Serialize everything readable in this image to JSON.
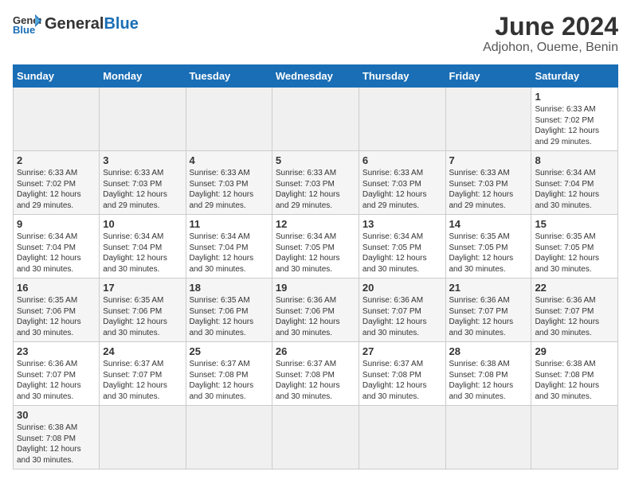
{
  "header": {
    "logo_general": "General",
    "logo_blue": "Blue",
    "title": "June 2024",
    "subtitle": "Adjohon, Oueme, Benin"
  },
  "days_of_week": [
    "Sunday",
    "Monday",
    "Tuesday",
    "Wednesday",
    "Thursday",
    "Friday",
    "Saturday"
  ],
  "weeks": [
    [
      {
        "day": "",
        "info": ""
      },
      {
        "day": "",
        "info": ""
      },
      {
        "day": "",
        "info": ""
      },
      {
        "day": "",
        "info": ""
      },
      {
        "day": "",
        "info": ""
      },
      {
        "day": "",
        "info": ""
      },
      {
        "day": "1",
        "info": "Sunrise: 6:33 AM\nSunset: 7:02 PM\nDaylight: 12 hours and 29 minutes."
      }
    ],
    [
      {
        "day": "2",
        "info": "Sunrise: 6:33 AM\nSunset: 7:02 PM\nDaylight: 12 hours and 29 minutes."
      },
      {
        "day": "3",
        "info": "Sunrise: 6:33 AM\nSunset: 7:03 PM\nDaylight: 12 hours and 29 minutes."
      },
      {
        "day": "4",
        "info": "Sunrise: 6:33 AM\nSunset: 7:03 PM\nDaylight: 12 hours and 29 minutes."
      },
      {
        "day": "5",
        "info": "Sunrise: 6:33 AM\nSunset: 7:03 PM\nDaylight: 12 hours and 29 minutes."
      },
      {
        "day": "6",
        "info": "Sunrise: 6:33 AM\nSunset: 7:03 PM\nDaylight: 12 hours and 29 minutes."
      },
      {
        "day": "7",
        "info": "Sunrise: 6:33 AM\nSunset: 7:03 PM\nDaylight: 12 hours and 29 minutes."
      },
      {
        "day": "8",
        "info": "Sunrise: 6:34 AM\nSunset: 7:04 PM\nDaylight: 12 hours and 30 minutes."
      }
    ],
    [
      {
        "day": "9",
        "info": "Sunrise: 6:34 AM\nSunset: 7:04 PM\nDaylight: 12 hours and 30 minutes."
      },
      {
        "day": "10",
        "info": "Sunrise: 6:34 AM\nSunset: 7:04 PM\nDaylight: 12 hours and 30 minutes."
      },
      {
        "day": "11",
        "info": "Sunrise: 6:34 AM\nSunset: 7:04 PM\nDaylight: 12 hours and 30 minutes."
      },
      {
        "day": "12",
        "info": "Sunrise: 6:34 AM\nSunset: 7:05 PM\nDaylight: 12 hours and 30 minutes."
      },
      {
        "day": "13",
        "info": "Sunrise: 6:34 AM\nSunset: 7:05 PM\nDaylight: 12 hours and 30 minutes."
      },
      {
        "day": "14",
        "info": "Sunrise: 6:35 AM\nSunset: 7:05 PM\nDaylight: 12 hours and 30 minutes."
      },
      {
        "day": "15",
        "info": "Sunrise: 6:35 AM\nSunset: 7:05 PM\nDaylight: 12 hours and 30 minutes."
      }
    ],
    [
      {
        "day": "16",
        "info": "Sunrise: 6:35 AM\nSunset: 7:06 PM\nDaylight: 12 hours and 30 minutes."
      },
      {
        "day": "17",
        "info": "Sunrise: 6:35 AM\nSunset: 7:06 PM\nDaylight: 12 hours and 30 minutes."
      },
      {
        "day": "18",
        "info": "Sunrise: 6:35 AM\nSunset: 7:06 PM\nDaylight: 12 hours and 30 minutes."
      },
      {
        "day": "19",
        "info": "Sunrise: 6:36 AM\nSunset: 7:06 PM\nDaylight: 12 hours and 30 minutes."
      },
      {
        "day": "20",
        "info": "Sunrise: 6:36 AM\nSunset: 7:07 PM\nDaylight: 12 hours and 30 minutes."
      },
      {
        "day": "21",
        "info": "Sunrise: 6:36 AM\nSunset: 7:07 PM\nDaylight: 12 hours and 30 minutes."
      },
      {
        "day": "22",
        "info": "Sunrise: 6:36 AM\nSunset: 7:07 PM\nDaylight: 12 hours and 30 minutes."
      }
    ],
    [
      {
        "day": "23",
        "info": "Sunrise: 6:36 AM\nSunset: 7:07 PM\nDaylight: 12 hours and 30 minutes."
      },
      {
        "day": "24",
        "info": "Sunrise: 6:37 AM\nSunset: 7:07 PM\nDaylight: 12 hours and 30 minutes."
      },
      {
        "day": "25",
        "info": "Sunrise: 6:37 AM\nSunset: 7:08 PM\nDaylight: 12 hours and 30 minutes."
      },
      {
        "day": "26",
        "info": "Sunrise: 6:37 AM\nSunset: 7:08 PM\nDaylight: 12 hours and 30 minutes."
      },
      {
        "day": "27",
        "info": "Sunrise: 6:37 AM\nSunset: 7:08 PM\nDaylight: 12 hours and 30 minutes."
      },
      {
        "day": "28",
        "info": "Sunrise: 6:38 AM\nSunset: 7:08 PM\nDaylight: 12 hours and 30 minutes."
      },
      {
        "day": "29",
        "info": "Sunrise: 6:38 AM\nSunset: 7:08 PM\nDaylight: 12 hours and 30 minutes."
      }
    ],
    [
      {
        "day": "30",
        "info": "Sunrise: 6:38 AM\nSunset: 7:08 PM\nDaylight: 12 hours and 30 minutes."
      },
      {
        "day": "",
        "info": ""
      },
      {
        "day": "",
        "info": ""
      },
      {
        "day": "",
        "info": ""
      },
      {
        "day": "",
        "info": ""
      },
      {
        "day": "",
        "info": ""
      },
      {
        "day": "",
        "info": ""
      }
    ]
  ]
}
